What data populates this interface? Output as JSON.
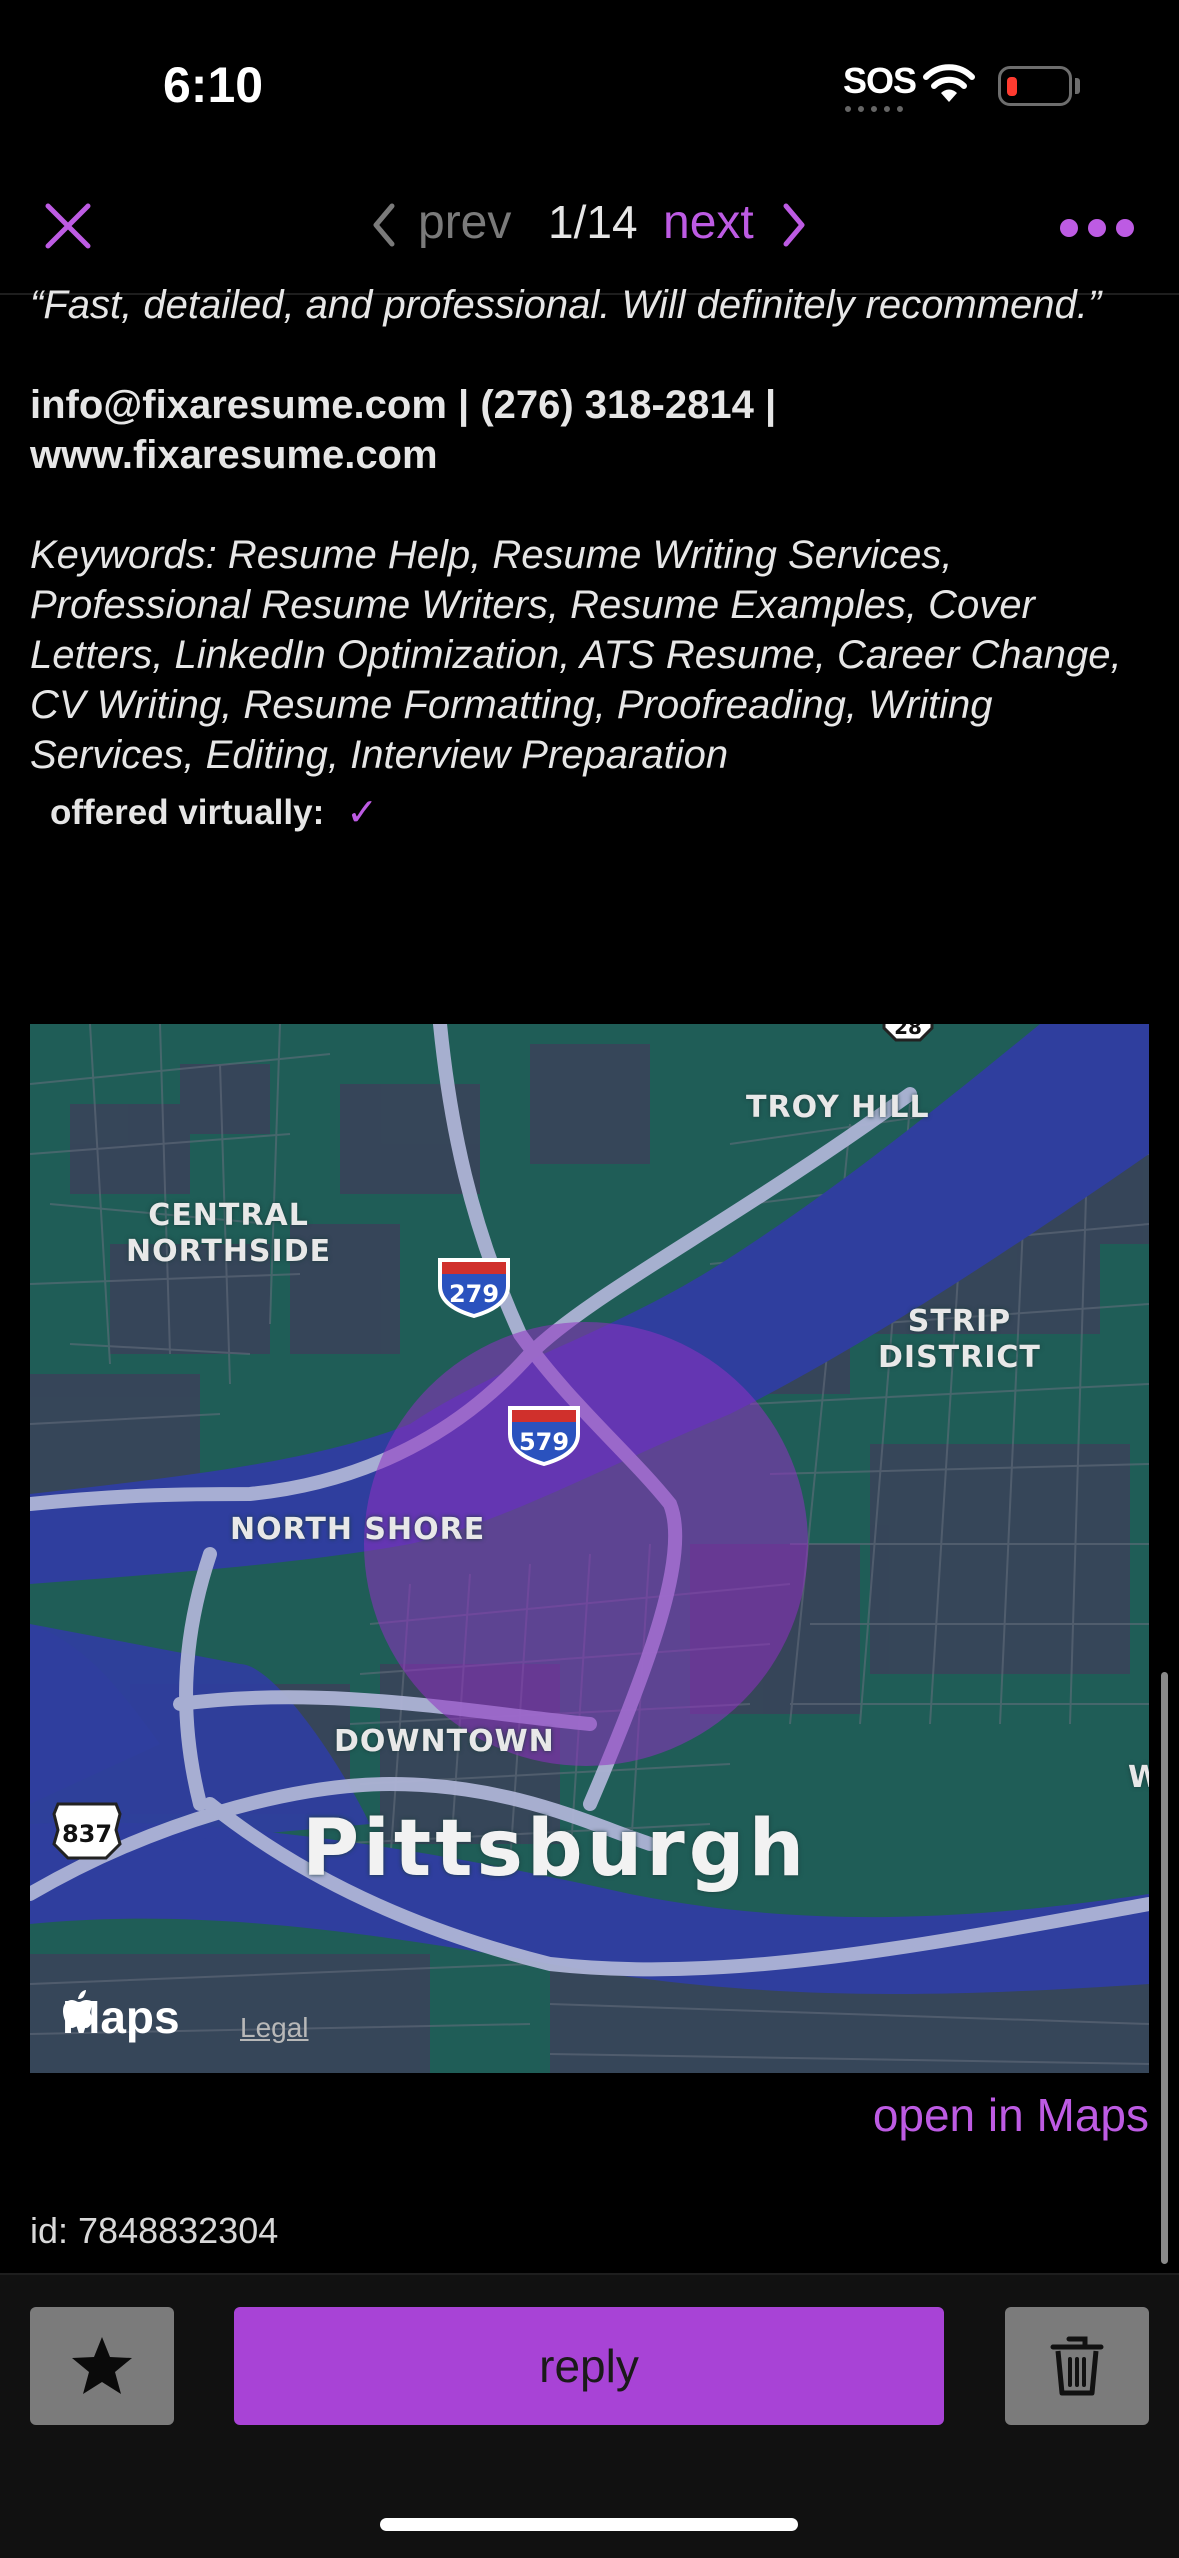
{
  "status_bar": {
    "time": "6:10",
    "sos": "SOS",
    "battery_level": 0.1
  },
  "nav": {
    "prev_label": "prev",
    "counter": "1/14",
    "next_label": "next",
    "accent_color": "#bd5be3"
  },
  "post": {
    "quote_text": "“Fast, detailed, and professional. Will definitely recommend.”",
    "contact_text": "info@fixaresume.com | (276) 318-2814 | www.fixaresume.com",
    "keywords_text": "Keywords: Resume Help, Resume Writing Services, Professional Resume Writers, Resume Examples, Cover Letters, LinkedIn Optimization, ATS Resume, Career Change, CV Writing, Resume Formatting, Proofreading, Writing Services, Editing, Interview Preparation",
    "virtual_label": "offered virtually:",
    "virtual_check": "✓",
    "id_text": "id: 7848832304"
  },
  "map": {
    "labels": {
      "troy_hill": "TROY HILL",
      "central_northside": "CENTRAL\nNORTHSIDE",
      "strip_district": "STRIP\nDISTRICT",
      "north_shore": "NORTH SHORE",
      "downtown": "DOWNTOWN",
      "pittsburgh": "Pittsburgh",
      "edge_w": "W"
    },
    "shields": {
      "i279": "279",
      "i579": "579",
      "r837": "837",
      "r28": "28"
    },
    "brand": "Maps",
    "legal": "Legal",
    "open_in_maps": "open in Maps"
  },
  "bottom_bar": {
    "reply_label": "reply"
  }
}
